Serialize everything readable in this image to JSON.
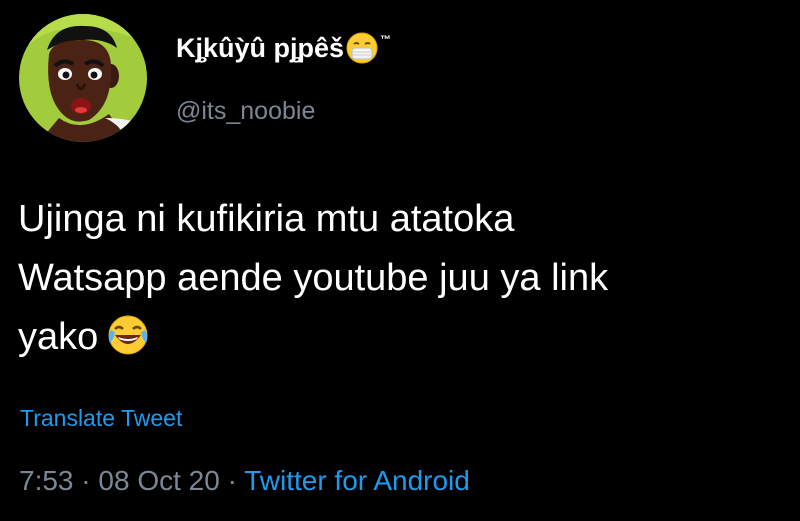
{
  "tweet": {
    "display_name": "Kj̧kûỳû pj̧pêš",
    "trademark": "™",
    "handle": "@its_noobie",
    "text_lines": [
      "Ujinga ni kufikiria mtu atatoka",
      "Watsapp aende youtube juu ya link",
      "yako"
    ],
    "translate_label": "Translate Tweet",
    "time": "7:53",
    "date": "08 Oct 20",
    "separator": "·",
    "source": "Twitter for Android"
  },
  "icons": {
    "avatar": "cartoon-avatar",
    "name_emoji": "face-with-medical-mask-icon",
    "text_emoji": "face-with-tears-of-joy-icon"
  },
  "colors": {
    "background": "#000000",
    "link": "#1d9bf0",
    "muted": "#7b8794",
    "avatar_bg": "#a3cc3d"
  }
}
